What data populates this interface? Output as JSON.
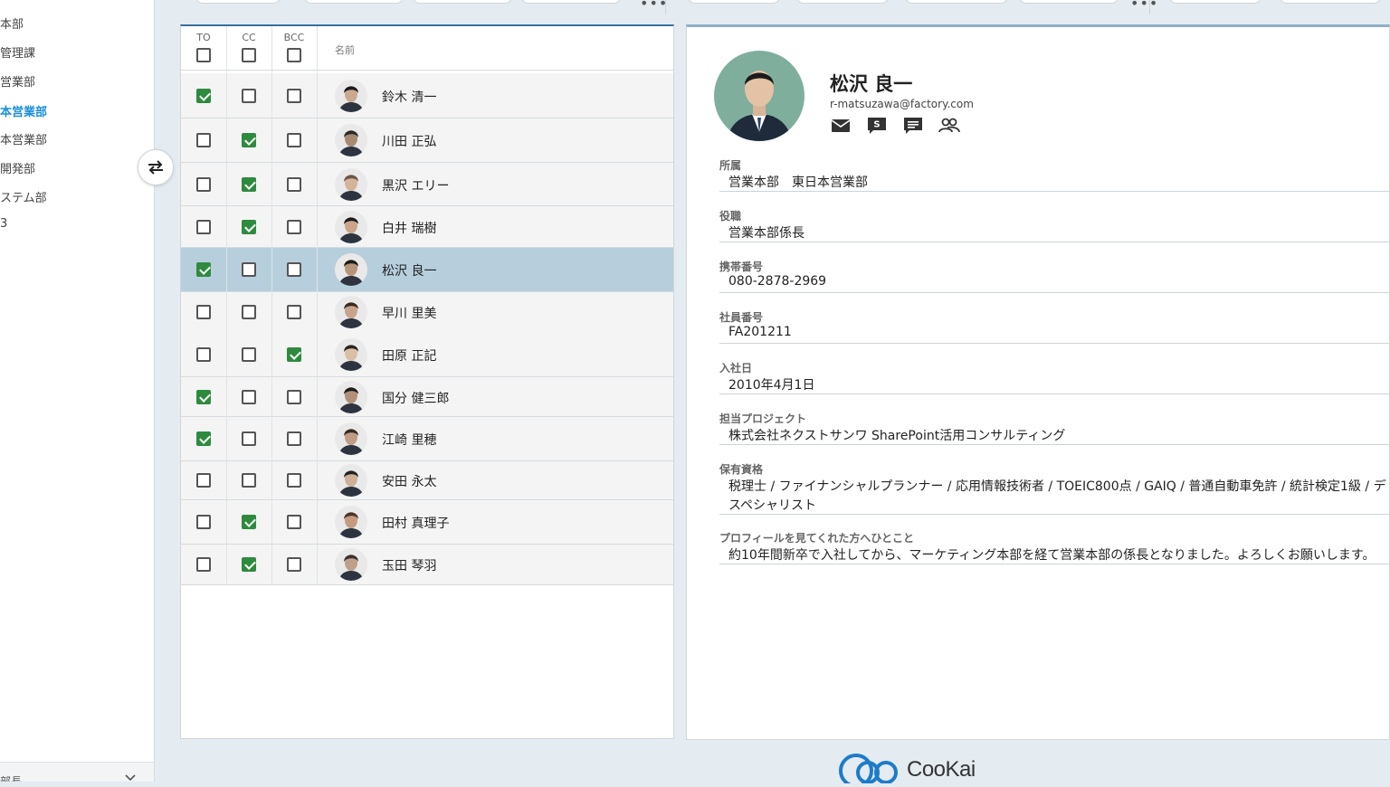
{
  "sidebar": {
    "items": [
      {
        "label": "本部",
        "active": false
      },
      {
        "label": "管理課",
        "active": false
      },
      {
        "label": "営業部",
        "active": false
      },
      {
        "label": "本営業部",
        "active": true
      },
      {
        "label": "本営業部",
        "active": false
      },
      {
        "label": "開発部",
        "active": false
      },
      {
        "label": "ステム部",
        "active": false
      },
      {
        "label": "3",
        "active": false
      }
    ],
    "bottom_label": "部長",
    "bottom_chevron": "chevron-down-icon",
    "swap_icon": "swap-arrows-icon"
  },
  "list": {
    "headers": {
      "to": "TO",
      "cc": "CC",
      "bcc": "BCC",
      "name": "名前"
    },
    "rows": [
      {
        "name": "鈴木 清一",
        "to": true,
        "cc": false,
        "bcc": false,
        "selected": false
      },
      {
        "name": "川田 正弘",
        "to": false,
        "cc": true,
        "bcc": false,
        "selected": false
      },
      {
        "name": "黒沢 エリー",
        "to": false,
        "cc": true,
        "bcc": false,
        "selected": false
      },
      {
        "name": "白井 瑞樹",
        "to": false,
        "cc": true,
        "bcc": false,
        "selected": false
      },
      {
        "name": "松沢 良一",
        "to": true,
        "cc": false,
        "bcc": false,
        "selected": true
      },
      {
        "name": "早川 里美",
        "to": false,
        "cc": false,
        "bcc": false,
        "selected": false
      },
      {
        "name": "田原 正記",
        "to": false,
        "cc": false,
        "bcc": true,
        "selected": false
      },
      {
        "name": "国分 健三郎",
        "to": true,
        "cc": false,
        "bcc": false,
        "selected": false
      },
      {
        "name": "江崎 里穂",
        "to": true,
        "cc": false,
        "bcc": false,
        "selected": false
      },
      {
        "name": "安田 永太",
        "to": false,
        "cc": false,
        "bcc": false,
        "selected": false
      },
      {
        "name": "田村 真理子",
        "to": false,
        "cc": true,
        "bcc": false,
        "selected": false
      },
      {
        "name": "玉田 琴羽",
        "to": false,
        "cc": true,
        "bcc": false,
        "selected": false
      }
    ]
  },
  "profile": {
    "name": "松沢 良一",
    "email": "r-matsuzawa@factory.com",
    "actions": [
      "mail-icon",
      "skype-icon",
      "chat-icon",
      "people-icon"
    ],
    "fields": [
      {
        "label": "所属",
        "value": "営業本部　東日本営業部"
      },
      {
        "label": "役職",
        "value": "営業本部係長"
      },
      {
        "label": "携帯番号",
        "value": "080-2878-2969"
      },
      {
        "label": "社員番号",
        "value": "FA201211"
      },
      {
        "label": "入社日",
        "value": "2010年4月1日"
      },
      {
        "label": "担当プロジェクト",
        "value": "株式会社ネクストサンワ SharePoint活用コンサルティング"
      },
      {
        "label": "保有資格",
        "value": "税理士 / ファイナンシャルプランナー / 応用情報技術者 / TOEIC800点 / GAIQ / 普通自動車免許 / 統計検定1級 / デ",
        "value2": "スペシャリスト"
      },
      {
        "label": "プロフィールを見てくれた方へひとこと",
        "value": "約10年間新卒で入社してから、マーケティング本部を経て営業本部の係長となりました。よろしくお願いします。"
      }
    ]
  },
  "footer": {
    "logo_text": "CooKai"
  },
  "colors": {
    "accent": "#1a8fd6",
    "check": "#2e8b3e",
    "selected_row": "#b7cfdd",
    "header_border": "#3a6f9b"
  }
}
